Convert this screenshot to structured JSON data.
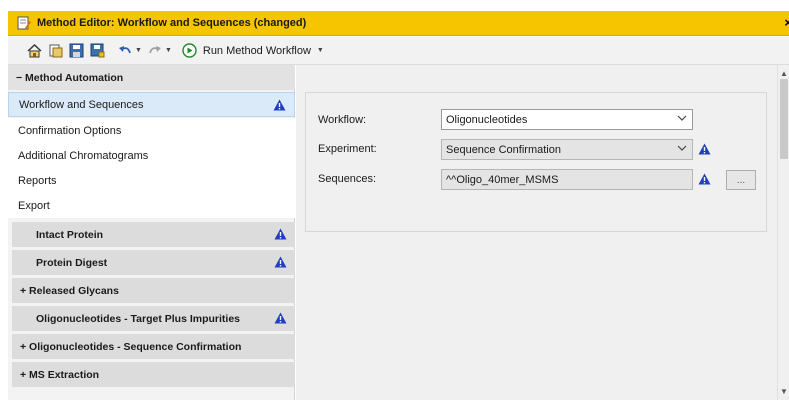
{
  "window": {
    "title": "Method Editor: Workflow and Sequences (changed)",
    "close_label": "×"
  },
  "toolbar": {
    "run_label": "Run Method Workflow",
    "buttons": [
      "home-icon",
      "add-method-icon",
      "save-icon",
      "save-as-icon",
      "undo-icon",
      "redo-icon"
    ]
  },
  "sidebar": {
    "section_title": "−  Method Automation",
    "items": [
      {
        "label": "Workflow and Sequences",
        "selected": true,
        "warning": true
      },
      {
        "label": "Confirmation Options"
      },
      {
        "label": "Additional Chromatograms"
      },
      {
        "label": "Reports"
      },
      {
        "label": "Export"
      }
    ],
    "groups": [
      {
        "label": "Intact Protein",
        "warning": true
      },
      {
        "label": "Protein Digest",
        "warning": true
      },
      {
        "label": "+  Released Glycans"
      },
      {
        "label": "Oligonucleotides - Target Plus Impurities",
        "warning": true
      },
      {
        "label": "+  Oligonucleotides - Sequence Confirmation"
      },
      {
        "label": "+  MS Extraction"
      }
    ]
  },
  "form": {
    "workflow_label": "Workflow:",
    "workflow_value": "Oligonucleotides",
    "experiment_label": "Experiment:",
    "experiment_value": "Sequence Confirmation",
    "sequences_label": "Sequences:",
    "sequences_value": "^^Oligo_40mer_MSMS",
    "browse_label": "..."
  },
  "colors": {
    "title_bar": "#f7c400",
    "selected_item": "#dbeaf8",
    "warning_icon": "#1f3fbf"
  }
}
